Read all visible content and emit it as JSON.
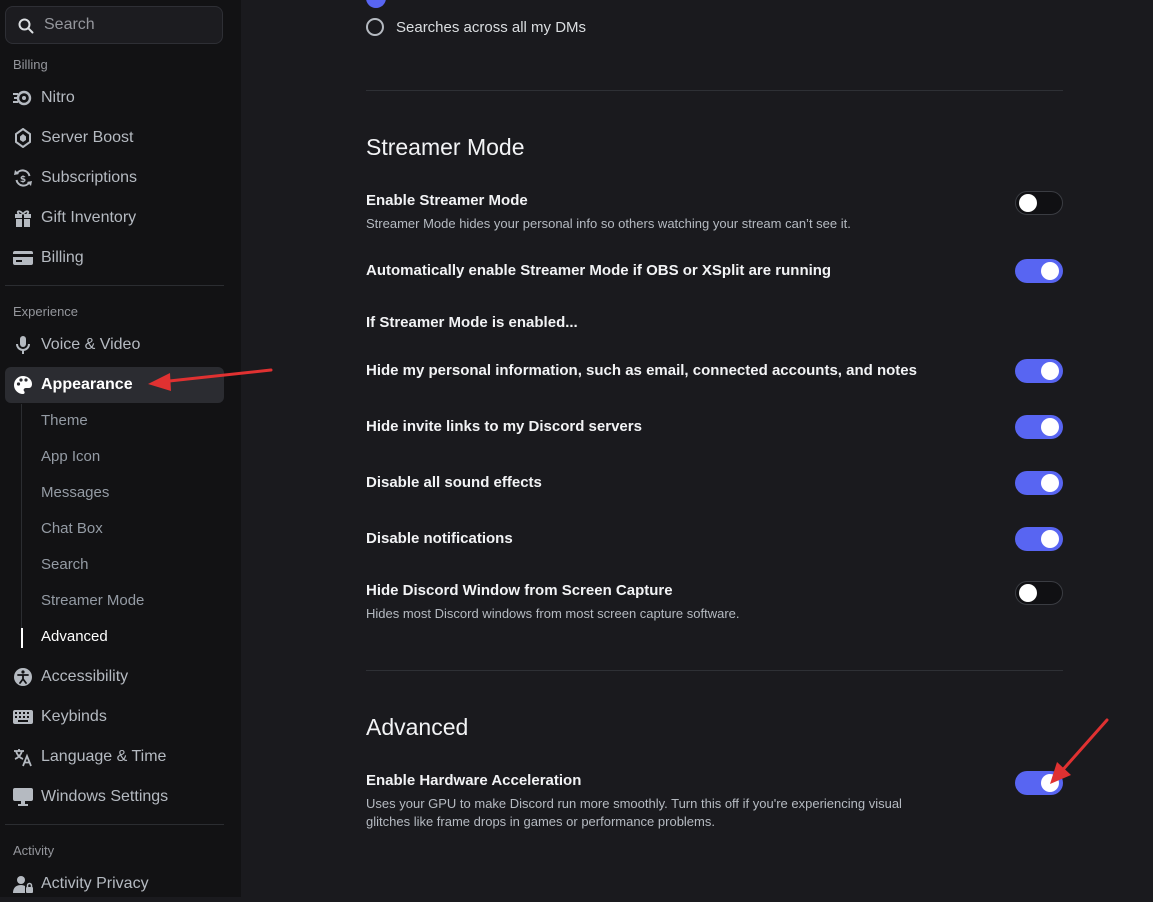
{
  "search": {
    "placeholder": "Search"
  },
  "sidebar": {
    "billing_label": "Billing",
    "billing_items": [
      {
        "label": "Nitro",
        "icon": "nitro-icon"
      },
      {
        "label": "Server Boost",
        "icon": "boost-icon"
      },
      {
        "label": "Subscriptions",
        "icon": "subscriptions-icon"
      },
      {
        "label": "Gift Inventory",
        "icon": "gift-icon"
      },
      {
        "label": "Billing",
        "icon": "credit-card-icon"
      }
    ],
    "experience_label": "Experience",
    "experience_items": [
      {
        "label": "Voice & Video",
        "icon": "microphone-icon"
      },
      {
        "label": "Appearance",
        "icon": "palette-icon",
        "selected": true
      }
    ],
    "appearance_sub_items": [
      "Theme",
      "App Icon",
      "Messages",
      "Chat Box",
      "Search",
      "Streamer Mode",
      "Advanced"
    ],
    "appearance_active_sub": "Advanced",
    "more_items": [
      {
        "label": "Accessibility",
        "icon": "accessibility-icon"
      },
      {
        "label": "Keybinds",
        "icon": "keyboard-icon"
      },
      {
        "label": "Language & Time",
        "icon": "language-icon"
      },
      {
        "label": "Windows Settings",
        "icon": "monitor-icon"
      }
    ],
    "activity_label": "Activity",
    "activity_items": [
      {
        "label": "Activity Privacy",
        "icon": "user-privacy-icon"
      }
    ]
  },
  "content": {
    "search_scope_option": "Searches across all my DMs",
    "streamer_heading": "Streamer Mode",
    "settings": [
      {
        "title": "Enable Streamer Mode",
        "desc": "Streamer Mode hides your personal info so others watching your stream can’t see it.",
        "on": false
      },
      {
        "title": "Automatically enable Streamer Mode if OBS or XSplit are running",
        "on": true
      },
      {
        "title": "If Streamer Mode is enabled..."
      },
      {
        "title": "Hide my personal information, such as email, connected accounts, and notes",
        "on": true
      },
      {
        "title": "Hide invite links to my Discord servers",
        "on": true
      },
      {
        "title": "Disable all sound effects",
        "on": true
      },
      {
        "title": "Disable notifications",
        "on": true
      },
      {
        "title": "Hide Discord Window from Screen Capture",
        "desc": "Hides most Discord windows from most screen capture software.",
        "on": false
      }
    ],
    "advanced_heading": "Advanced",
    "hardware": {
      "title": "Enable Hardware Acceleration",
      "desc_line1": "Uses your GPU to make Discord run more smoothly. Turn this off if you're experiencing visual",
      "desc_line2": "glitches like frame drops in games or performance problems.",
      "on": true
    }
  },
  "colors": {
    "accent": "#5865f2",
    "annotation_arrow": "#e03131",
    "background": "#1a1a1e",
    "sidebar": "#121214"
  }
}
